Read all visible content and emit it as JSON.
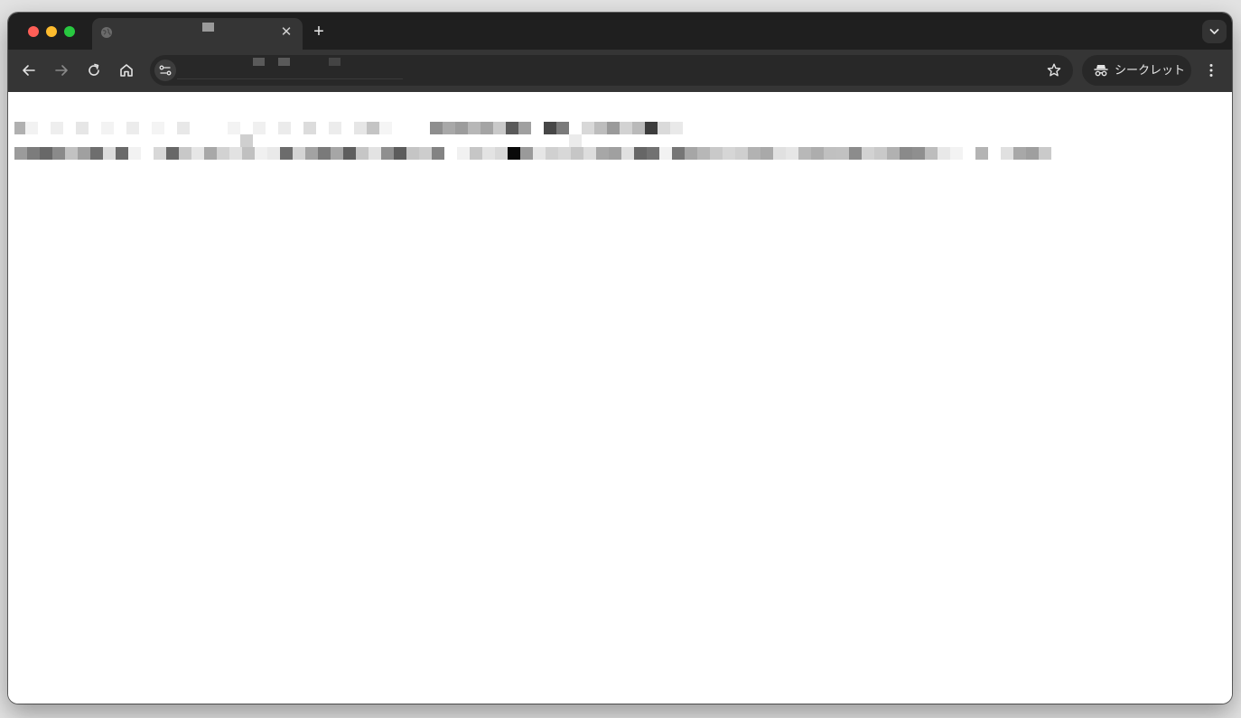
{
  "browser": {
    "tab": {
      "title": "",
      "close_glyph": "✕"
    },
    "new_tab_glyph": "+",
    "address_bar": {
      "url": ""
    },
    "profile": {
      "label": "シークレット"
    }
  },
  "icons": {
    "back": "arrow-left-icon",
    "forward": "arrow-right-icon",
    "reload": "reload-icon",
    "home": "home-icon",
    "site_info": "tune-icon",
    "bookmark": "star-icon",
    "incognito": "incognito-icon",
    "menu": "more-vertical-icon",
    "tab_search": "chevron-down-icon",
    "favicon": "globe-icon"
  },
  "colors": {
    "tabstrip": "#1f1f1f",
    "toolbar": "#353535",
    "omnibox": "#282828",
    "close": "#ff5f57",
    "minimize": "#febc2e",
    "maximize": "#28c840"
  },
  "content": {
    "line1": "",
    "line2": ""
  }
}
